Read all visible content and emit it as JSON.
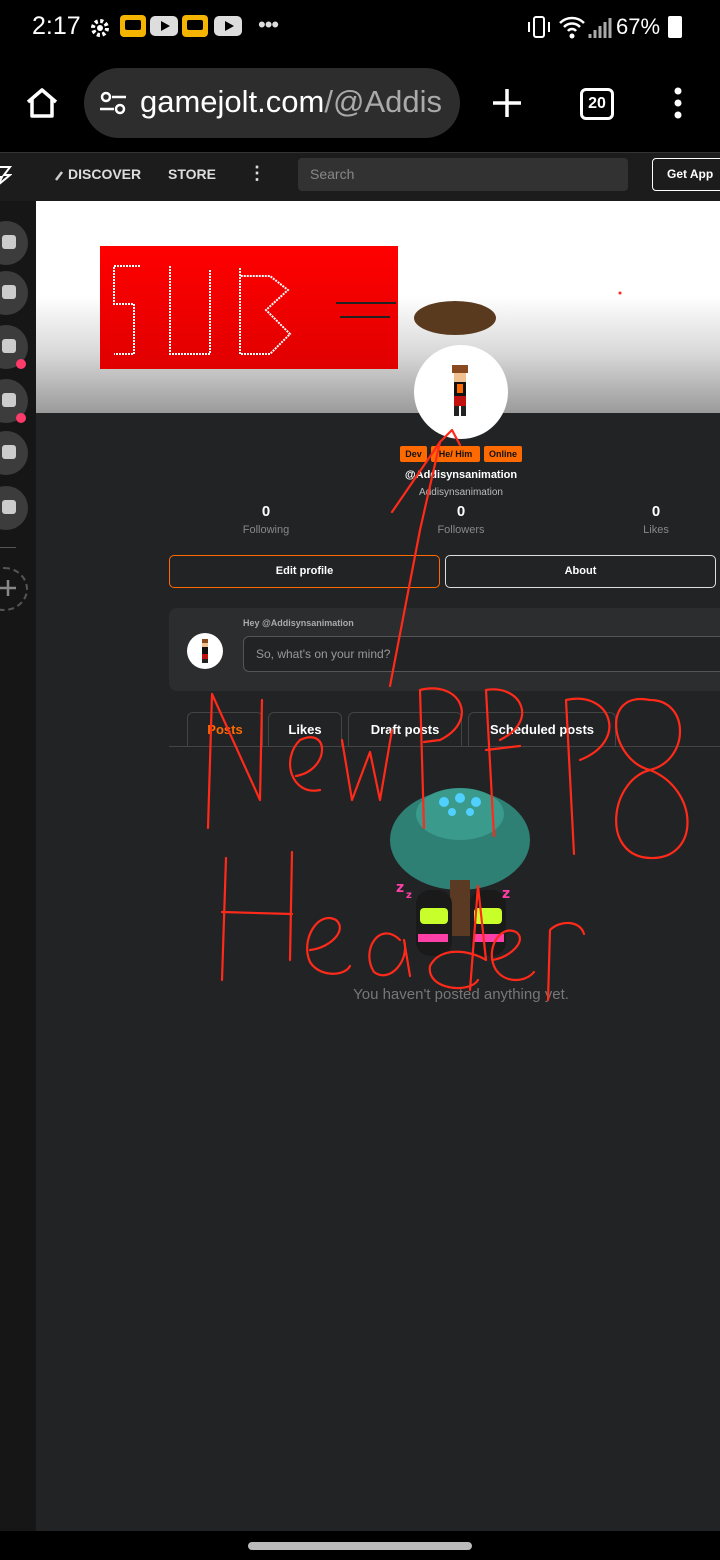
{
  "status_bar": {
    "time": "2:17",
    "battery": "67%",
    "overflow": "•••"
  },
  "browser": {
    "url_domain": "gamejolt.com",
    "url_path": "/@Addis",
    "tab_count": "20"
  },
  "nav": {
    "discover": "DISCOVER",
    "store": "STORE",
    "more": "⋮",
    "search_placeholder": "Search",
    "get_app": "Get App"
  },
  "profile": {
    "badges": [
      "Dev",
      "He/ Him",
      "Online"
    ],
    "username": "@Addisynsanimation",
    "display_name": "Addisynsanimation",
    "stats": [
      {
        "value": "0",
        "label": "Following"
      },
      {
        "value": "0",
        "label": "Followers"
      },
      {
        "value": "0",
        "label": "Likes"
      }
    ],
    "edit_profile": "Edit profile",
    "about": "About"
  },
  "composer": {
    "greeting": "Hey @Addisynsanimation",
    "placeholder": "So, what's on your mind?"
  },
  "tabs": [
    "Posts",
    "Likes",
    "Draft posts",
    "Scheduled posts"
  ],
  "active_tab": "Posts",
  "empty_state": "You haven't posted anything yet.",
  "colors": {
    "accent": "#ff6a00",
    "annotation": "#ff2a1a",
    "background": "#222325"
  }
}
